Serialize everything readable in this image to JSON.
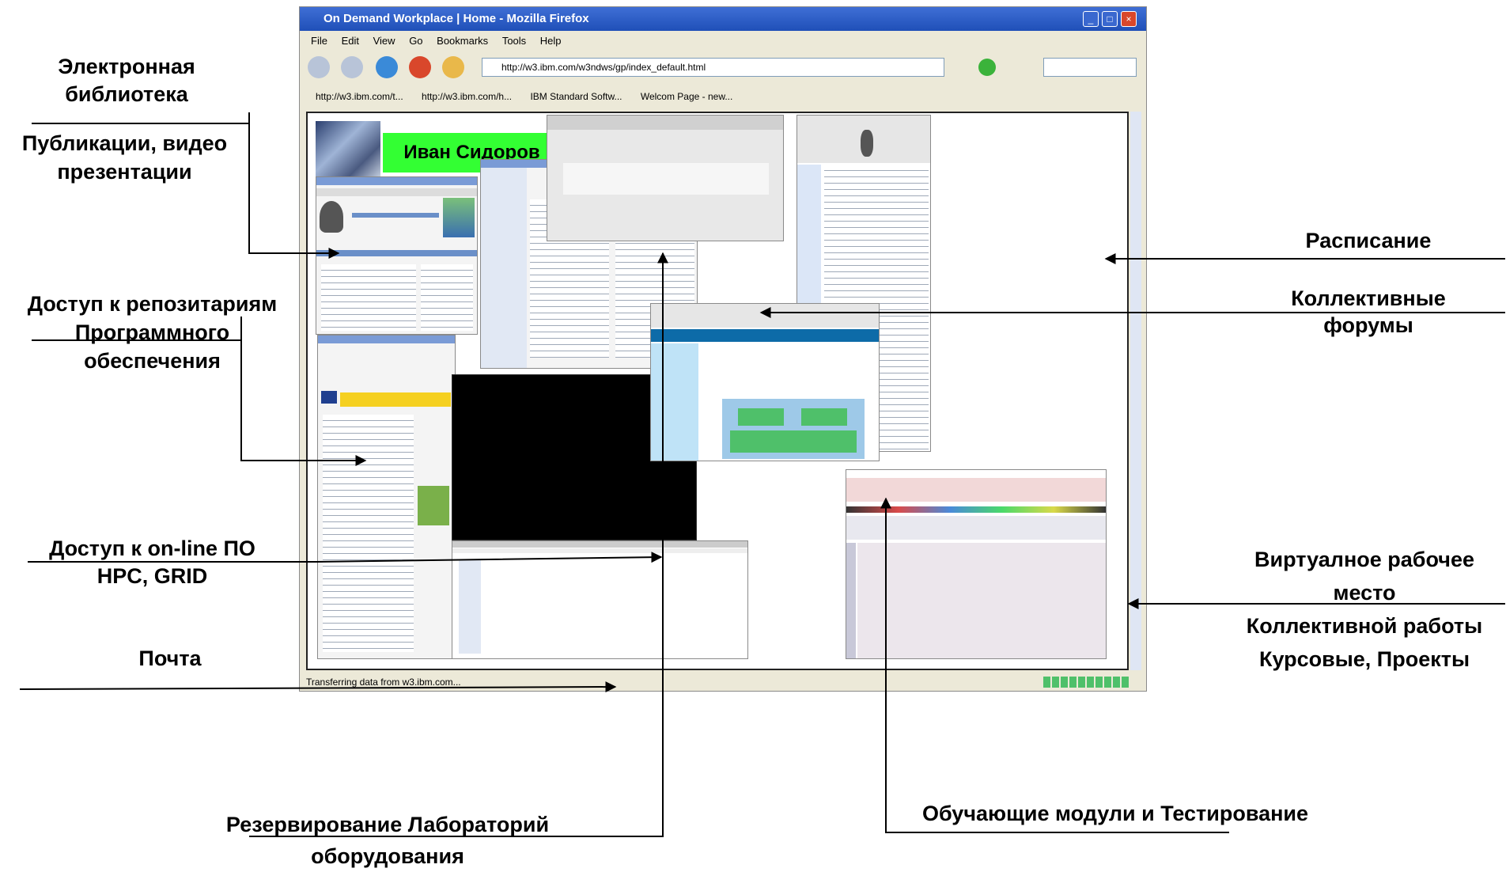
{
  "browser": {
    "title": "On Demand Workplace | Home - Mozilla Firefox",
    "menu": [
      "File",
      "Edit",
      "View",
      "Go",
      "Bookmarks",
      "Tools",
      "Help"
    ],
    "url": "http://w3.ibm.com/w3ndws/gp/index_default.html",
    "bookmarks": [
      "http://w3.ibm.com/t...",
      "http://w3.ibm.com/h...",
      "IBM Standard Softw...",
      "Welcom Page - new..."
    ],
    "status": "Transferring data from w3.ibm.com...",
    "user_name": "Иван Сидоров"
  },
  "labels": {
    "elib_1": "Электронная",
    "elib_2": "библиотека",
    "pub_1": "Публикации, видео",
    "pub_2": "презентации",
    "repo_1": "Доступ к репозитариям",
    "repo_2": "Программного",
    "repo_3": "обеспечения",
    "online_1": "Доступ к on-line ПО",
    "online_2": "HPC, GRID",
    "mail": "Почта",
    "lab_1": "Резервирование Лабораторий",
    "lab_2": "оборудования",
    "schedule": "Расписание",
    "forums_1": "Коллективные",
    "forums_2": "форумы",
    "virtual_1": "Виртуалное рабочее",
    "virtual_2": "место",
    "virtual_3": "Коллективной работы",
    "virtual_4": "Курсовые, Проекты",
    "training": "Обучающие модули и Тестирование"
  }
}
